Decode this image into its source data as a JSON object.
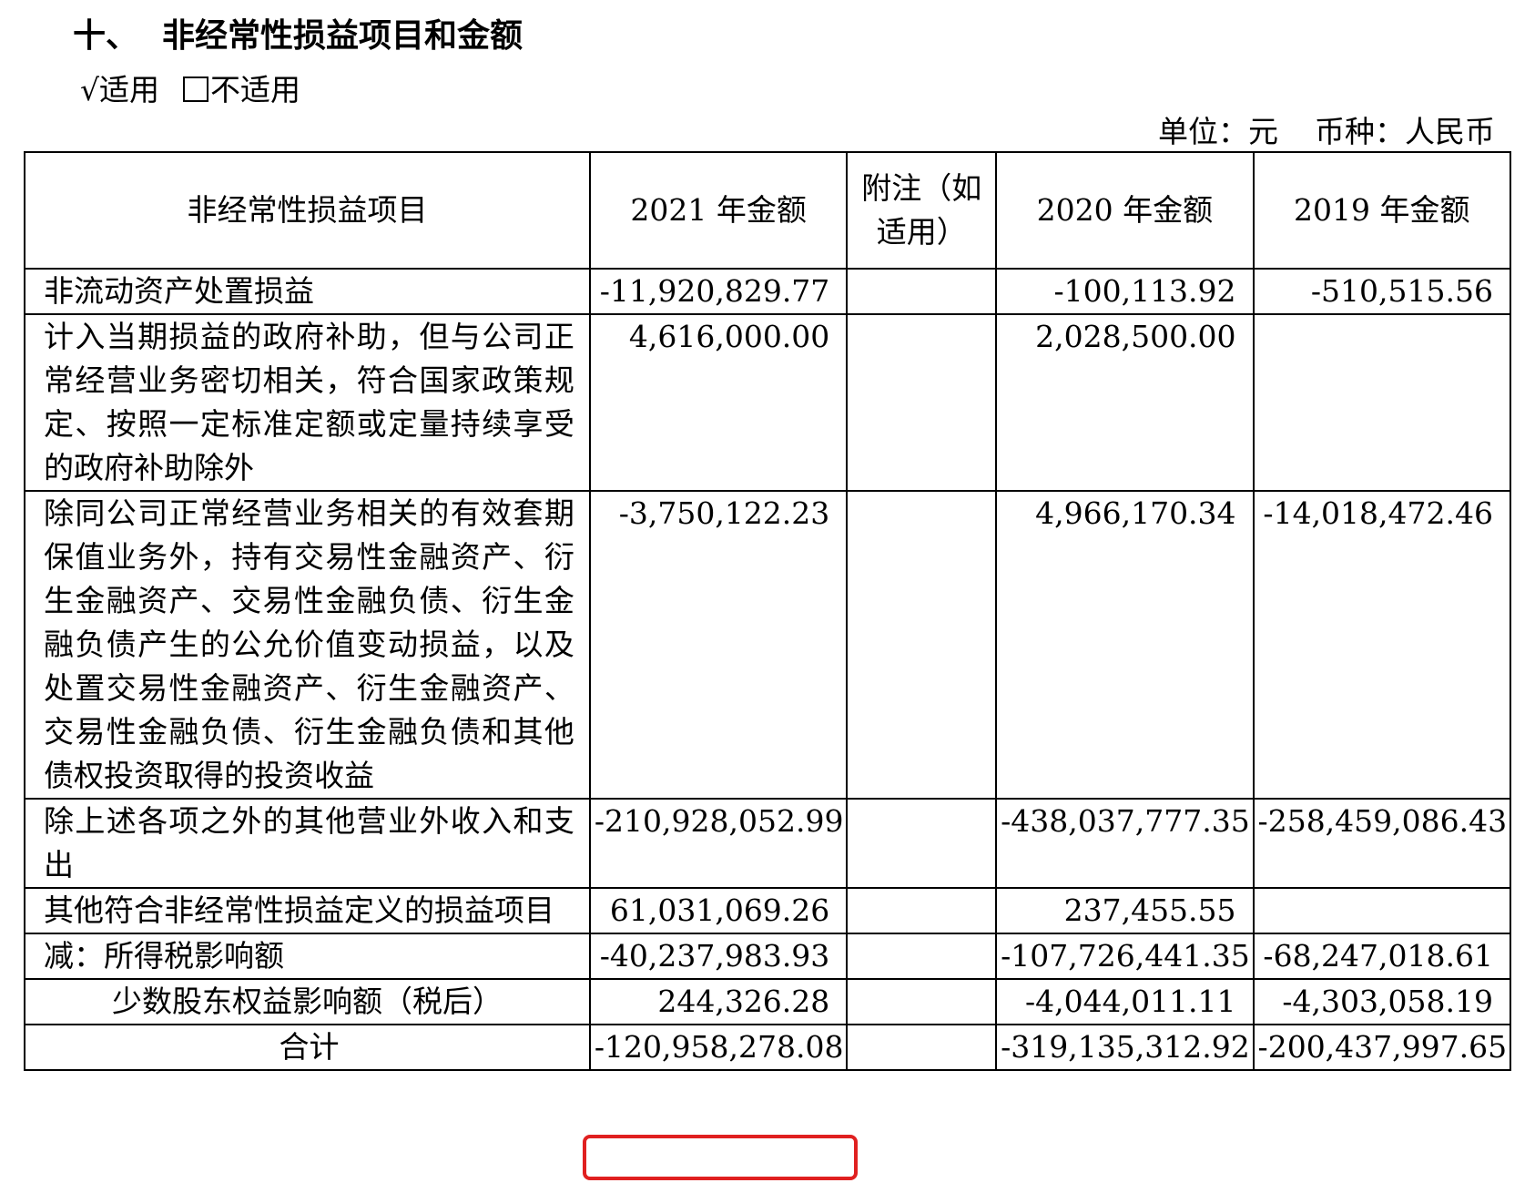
{
  "section": {
    "number": "十、",
    "title": "非经常性损益项目和金额"
  },
  "applicability": {
    "applicable_mark": "√",
    "applicable_label": "适用",
    "not_applicable_label": "不适用"
  },
  "unit": {
    "unit_text": "单位：元",
    "currency_text": "币种：人民币"
  },
  "table": {
    "headers": [
      "非经常性损益项目",
      "2021 年金额",
      "附注（如适用）",
      "2020 年金额",
      "2019 年金额"
    ],
    "rows": [
      {
        "item": "非流动资产处置损益",
        "y2021": "-11,920,829.77",
        "note": "",
        "y2020": "-100,113.92",
        "y2019": "-510,515.56"
      },
      {
        "item": "计入当期损益的政府补助，但与公司正常经营业务密切相关，符合国家政策规定、按照一定标准定额或定量持续享受的政府补助除外",
        "y2021": "4,616,000.00",
        "note": "",
        "y2020": "2,028,500.00",
        "y2019": ""
      },
      {
        "item": "除同公司正常经营业务相关的有效套期保值业务外，持有交易性金融资产、衍生金融资产、交易性金融负债、衍生金融负债产生的公允价值变动损益，以及处置交易性金融资产、衍生金融资产、交易性金融负债、衍生金融负债和其他债权投资取得的投资收益",
        "y2021": "-3,750,122.23",
        "note": "",
        "y2020": "4,966,170.34",
        "y2019": "-14,018,472.46"
      },
      {
        "item": "除上述各项之外的其他营业外收入和支出",
        "y2021": "-210,928,052.99",
        "note": "",
        "y2020": "-438,037,777.35",
        "y2019": "-258,459,086.43"
      },
      {
        "item": "其他符合非经常性损益定义的损益项目",
        "y2021": "61,031,069.26",
        "note": "",
        "y2020": "237,455.55",
        "y2019": ""
      },
      {
        "item": "减：所得税影响额",
        "y2021": "-40,237,983.93",
        "note": "",
        "y2020": "-107,726,441.35",
        "y2019": "-68,247,018.61"
      },
      {
        "item": "少数股东权益影响额（税后）",
        "y2021": "244,326.28",
        "note": "",
        "y2020": "-4,044,011.11",
        "y2019": "-4,303,058.19"
      },
      {
        "item": "合计",
        "y2021": "-120,958,278.08",
        "note": "",
        "y2020": "-319,135,312.92",
        "y2019": "-200,437,997.65"
      }
    ]
  },
  "highlight_color": "#e02020"
}
